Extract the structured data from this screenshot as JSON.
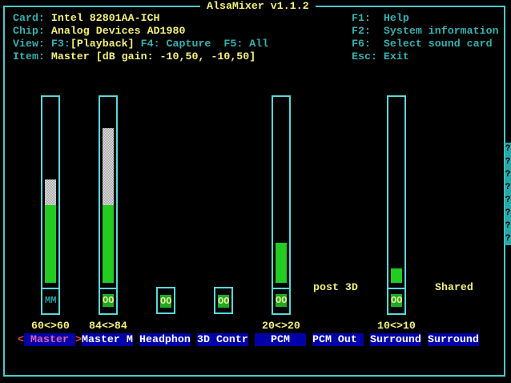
{
  "title": "AlsaMixer v1.1.2",
  "info": {
    "card_label": "Card:",
    "card": "Intel 82801AA-ICH",
    "chip_label": "Chip:",
    "chip": "Analog Devices AD1980",
    "view_label": "View:",
    "view_f3": "F3:",
    "view_playback": "[Playback]",
    "view_f4": "F4: Capture",
    "view_f5": "F5: All",
    "item_label": "Item:",
    "item": "Master [dB gain: -10,50, -10,50]"
  },
  "keys": [
    {
      "key": "F1:",
      "action": "Help"
    },
    {
      "key": "F2:",
      "action": "System information"
    },
    {
      "key": "F6:",
      "action": "Select sound card"
    },
    {
      "key": "Esc:",
      "action": "Exit"
    }
  ],
  "controls": [
    {
      "name": "Master",
      "value": "60<>60",
      "level": 60,
      "level_right": 60,
      "switch": "MM",
      "selected": true
    },
    {
      "name": "Master M",
      "value": "84<>84",
      "level": 84,
      "level_right": 84,
      "switch": "OO"
    },
    {
      "name": "Headphon",
      "switch": "OO"
    },
    {
      "name": "3D Contr",
      "switch": "OO"
    },
    {
      "name": "PCM",
      "value": "20<>20",
      "level": 20,
      "switch": "OO"
    },
    {
      "name": "PCM Out",
      "extra": "post 3D"
    },
    {
      "name": "Surround",
      "value": "10<>10",
      "level": 10,
      "switch": "OO"
    },
    {
      "name": "Surround",
      "extra": "Shared"
    }
  ],
  "selected_left_marker": "<",
  "selected_right_marker": ">",
  "scroll_marker": "?"
}
